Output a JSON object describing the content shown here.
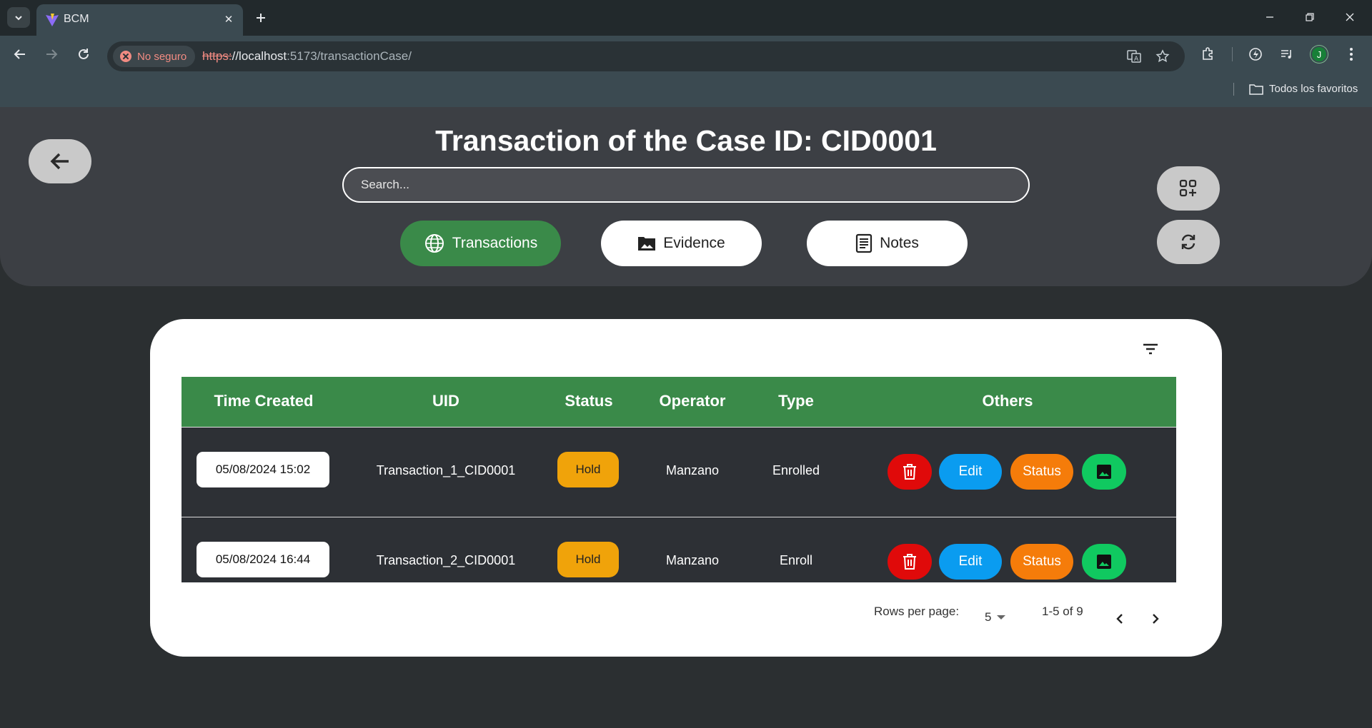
{
  "browser": {
    "tab_title": "BCM",
    "security_label": "No seguro",
    "url_scheme": "https:",
    "url_host": "//localhost",
    "url_rest": ":5173/transactionCase/",
    "bookmark_folder": "Todos los favoritos",
    "profile_initial": "J"
  },
  "header": {
    "title": "Transaction of the Case ID: CID0001",
    "search_placeholder": "Search...",
    "tabs": [
      {
        "label": "Transactions",
        "icon": "globe-icon",
        "active": true
      },
      {
        "label": "Evidence",
        "icon": "image-folder-icon",
        "active": false
      },
      {
        "label": "Notes",
        "icon": "notes-icon",
        "active": false
      }
    ]
  },
  "table": {
    "columns": [
      "Time Created",
      "UID",
      "Status",
      "Operator",
      "Type",
      "Others"
    ],
    "rows": [
      {
        "time": "05/08/2024 15:02",
        "uid": "Transaction_1_CID0001",
        "status": "Hold",
        "operator": "Manzano",
        "type": "Enrolled"
      },
      {
        "time": "05/08/2024 16:44",
        "uid": "Transaction_2_CID0001",
        "status": "Hold",
        "operator": "Manzano",
        "type": "Enroll"
      }
    ],
    "actions": {
      "edit": "Edit",
      "status": "Status"
    }
  },
  "pagination": {
    "rows_per_page_label": "Rows per page:",
    "rows_per_page_value": "5",
    "range": "1-5 of 9"
  },
  "colors": {
    "accent_green": "#3a8a49",
    "hold": "#f0a30a",
    "delete": "#e00a0a",
    "edit": "#0a9cf0",
    "status": "#f57c0a",
    "image": "#10c960"
  }
}
